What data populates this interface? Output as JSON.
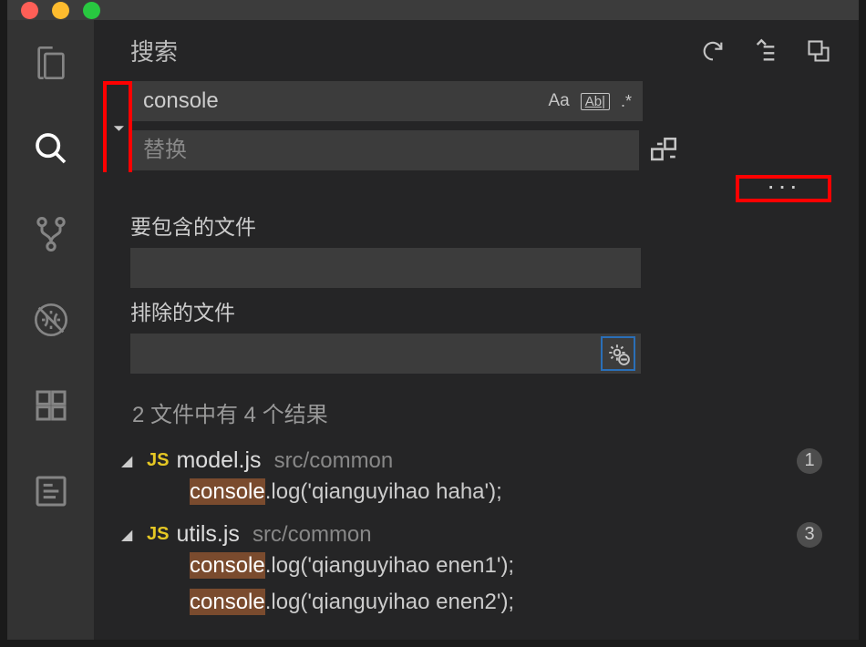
{
  "header": {
    "title": "搜索"
  },
  "search": {
    "value": "console",
    "replace_placeholder": "替换",
    "include_label": "要包含的文件",
    "exclude_label": "排除的文件",
    "case_label": "Aa",
    "word_label": "Ab|",
    "regex_label": ".*",
    "ellipsis": "···"
  },
  "results": {
    "summary": "2 文件中有 4 个结果",
    "files": [
      {
        "lang": "JS",
        "name": "model.js",
        "path": "src/common",
        "count": "1",
        "lines": [
          {
            "pre": "",
            "match": "console",
            "post": ".log('qianguyihao haha');"
          }
        ]
      },
      {
        "lang": "JS",
        "name": "utils.js",
        "path": "src/common",
        "count": "3",
        "lines": [
          {
            "pre": "",
            "match": "console",
            "post": ".log('qianguyihao enen1');"
          },
          {
            "pre": "",
            "match": "console",
            "post": ".log('qianguyihao enen2');"
          }
        ]
      }
    ]
  }
}
